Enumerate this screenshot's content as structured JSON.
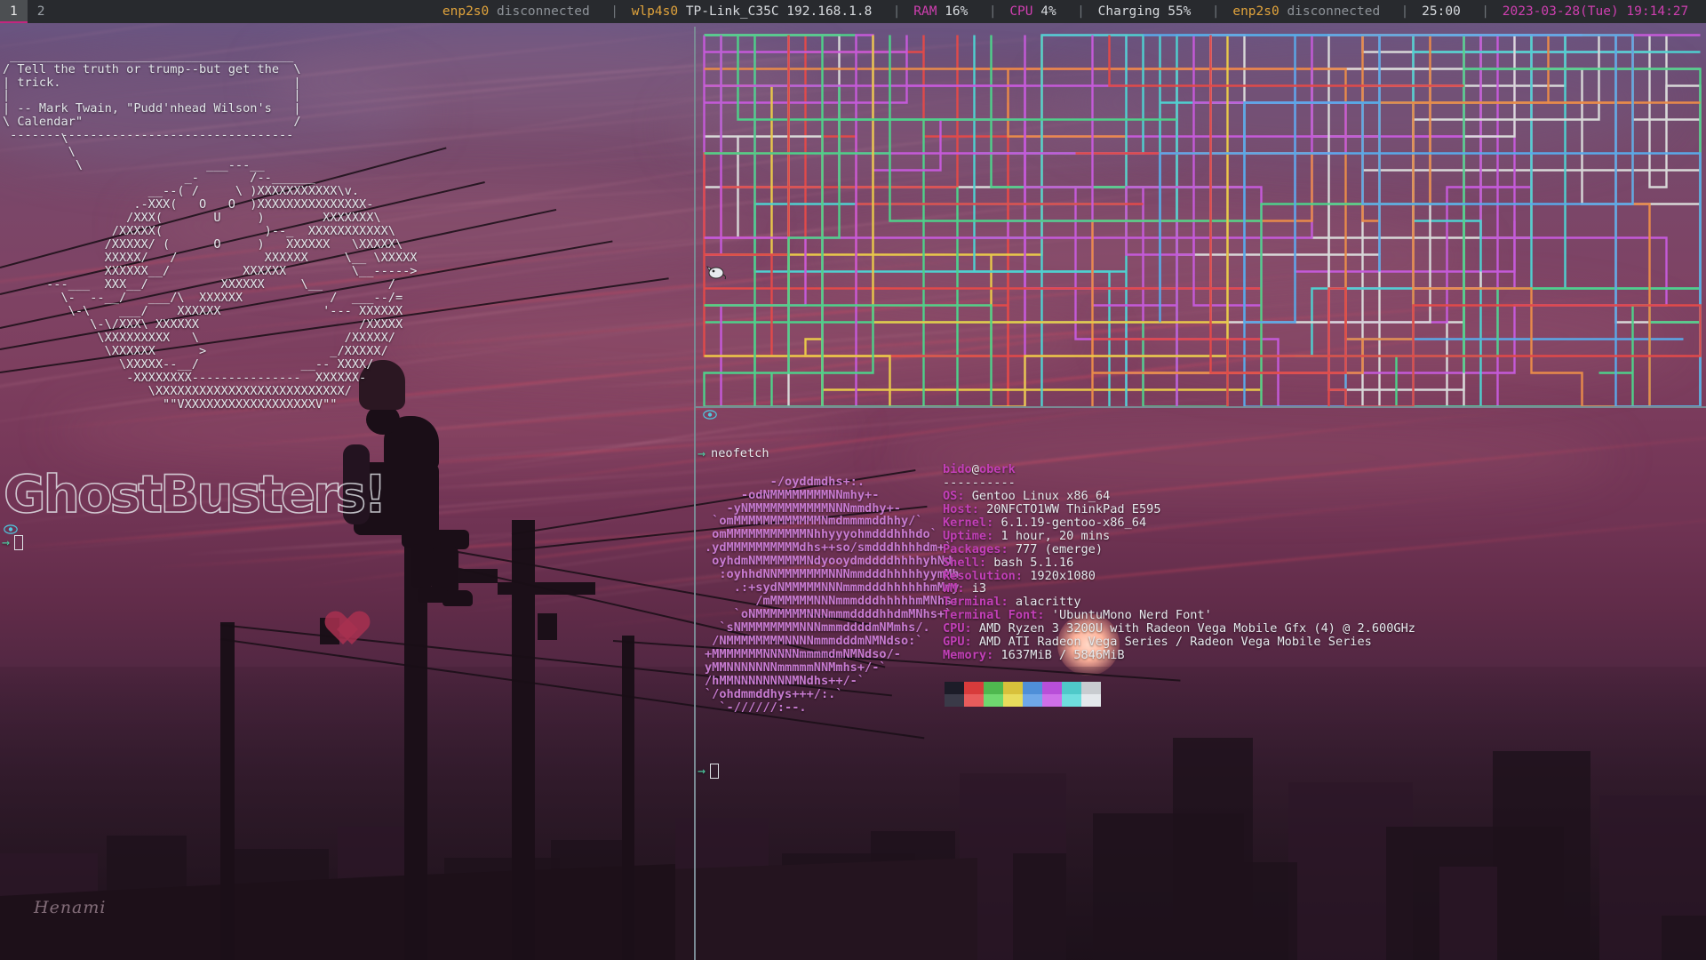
{
  "bar": {
    "workspaces": [
      {
        "name": "1",
        "focused": true
      },
      {
        "name": "2",
        "focused": false
      }
    ],
    "status": [
      {
        "text": "enp2s0",
        "color": "orange"
      },
      {
        "text": "disconnected",
        "color": "grey"
      },
      {
        "text": "|",
        "color": "sep"
      },
      {
        "text": "wlp4s0",
        "color": "orange"
      },
      {
        "text": "TP-Link_C35C 192.168.1.8",
        "color": "white"
      },
      {
        "text": "|",
        "color": "sep"
      },
      {
        "text": "RAM",
        "color": "magenta"
      },
      {
        "text": "16%",
        "color": "white"
      },
      {
        "text": "|",
        "color": "sep"
      },
      {
        "text": "CPU",
        "color": "magenta"
      },
      {
        "text": "4%",
        "color": "white"
      },
      {
        "text": "|",
        "color": "sep"
      },
      {
        "text": "Charging 55%",
        "color": "white"
      },
      {
        "text": "|",
        "color": "sep"
      },
      {
        "text": "enp2s0",
        "color": "orange"
      },
      {
        "text": "disconnected",
        "color": "grey"
      },
      {
        "text": "|",
        "color": "sep"
      },
      {
        "text": "25:00",
        "color": "white"
      },
      {
        "text": "|",
        "color": "sep"
      },
      {
        "text": "2023-03-28(Tue) 19:14:27",
        "color": "magenta"
      }
    ]
  },
  "left_terminal": {
    "quote_box": " _______________________________________\n/ Tell the truth or trump--but get the  \\\n| trick.                                |\n|                                       |\n| -- Mark Twain, \"Pudd'nhead Wilson's   |\n\\ Calendar\"                             /\n ---------------------------------------",
    "ghost_ascii": "        \\\n         \\\n          \\                 ___---__\n                         _-       /--______\n                    __--( /     \\ )XXXXXXXXXXX\\v.\n                  .-XXX(   O   O  )XXXXXXXXXXXXXXX-\n                 /XXX(       U     )        XXXXXXX\\\n               /XXXXX(              )--_  XXXXXXXXXXX\\\n              /XXXXX/ (      O     )   XXXXXX   \\XXXXX\\\n              XXXXX/   /            XXXXXX     \\__ \\XXXXX\n              XXXXXX__/          XXXXXX         \\__----->\n      ---___  XXX__/          XXXXXX     \\__         /\n        \\-  --__/   ___/\\  XXXXXX            /  ___--/=\n         \\-\\    ___/    XXXXXX              '--- XXXXXX\n            \\-\\/XXX\\ XXXXXX                      /XXXXX\n             \\XXXXXXXXX   \\                    /XXXXX/\n              \\XXXXXX      >                 _/XXXXX/\n                \\XXXXX--__/              __-- XXXX/\n                 -XXXXXXXX---------------  XXXXXX-\n                    \\XXXXXXXXXXXXXXXXXXXXXXXXXX/\n                      \"\"VXXXXXXXXXXXXXXXXXXV\"\"",
    "banner_text": "GhostBusters!",
    "prompt_arrow": "→"
  },
  "right_bottom": {
    "prompt_arrow": "→",
    "command": "neofetch",
    "logo_ascii": "         -/oyddmdhs+:.\n     -odNMMMMMMMMNNmhy+-\n   -yNMMMMMMMMMMMNNNmmdhy+-\n `omMMMMMMMMMMMMNmdmmmmddhhy/`\n omMMMMMMMMMMMNhhyyyohmdddhhhdo`\n.ydMMMMMMMMMMdhs++so/smdddhhhhdm+`\n oyhdmNMMMMMMMNdyooydmddddhhhhyhNd.\n  :oyhhdNNMMMMMMMNNNmmdddhhhhhyymMh\n    .:+sydNMMMMMNNNmmmdddhhhhhhmMmy\n       /mMMMMMMNNNmmmdddhhhhhmMNhs:\n    `oNMMMMMMMNNNmmmddddhhdmMNhs+`\n  `sNMMMMMMMMNNNmmmddddmNMmhs/.\n /NMMMMMMMMNNNNmmmdddmNMNdso:`\n+MMMMMMMNNNNNmmmmdmNMNdso/-\nyMMNNNNNNNmmmmmNNMmhs+/-`\n/hMMNNNNNNNNMNdhs++/-`\n`/ohdmmddhys+++/:.`\n  `-//////:--.",
    "user_host": "bido@oberk",
    "separator": "----------",
    "info": [
      {
        "label": "OS",
        "value": "Gentoo Linux x86_64"
      },
      {
        "label": "Host",
        "value": "20NFCTO1WW ThinkPad E595"
      },
      {
        "label": "Kernel",
        "value": "6.1.19-gentoo-x86_64"
      },
      {
        "label": "Uptime",
        "value": "1 hour, 20 mins"
      },
      {
        "label": "Packages",
        "value": "777 (emerge)"
      },
      {
        "label": "Shell",
        "value": "bash 5.1.16"
      },
      {
        "label": "Resolution",
        "value": "1920x1080"
      },
      {
        "label": "WM",
        "value": "i3"
      },
      {
        "label": "Terminal",
        "value": "alacritty"
      },
      {
        "label": "Terminal Font",
        "value": "'UbuntuMono Nerd Font'"
      },
      {
        "label": "CPU",
        "value": "AMD Ryzen 3 3200U with Radeon Vega Mobile Gfx (4) @ 2.600GHz"
      },
      {
        "label": "GPU",
        "value": "AMD ATI Radeon Vega Series / Radeon Vega Mobile Series"
      },
      {
        "label": "Memory",
        "value": "1637MiB / 5846MiB"
      }
    ],
    "palette_row1": [
      "#1c1c28",
      "#d83b3b",
      "#4fb84f",
      "#d8c13b",
      "#4f8fd8",
      "#b84fd8",
      "#4fc9c9",
      "#c8ccd0"
    ],
    "palette_row2": [
      "#3a3a48",
      "#e85c5c",
      "#6fd86f",
      "#e8dc5c",
      "#6fa8e8",
      "#cf6fe8",
      "#6fdede",
      "#e4e8ec"
    ]
  },
  "colors": {
    "bar_bg": "#282a2e",
    "accent_magenta": "#cf3fb0",
    "accent_orange": "#e0a33c",
    "split_border": "#7a8a94"
  }
}
